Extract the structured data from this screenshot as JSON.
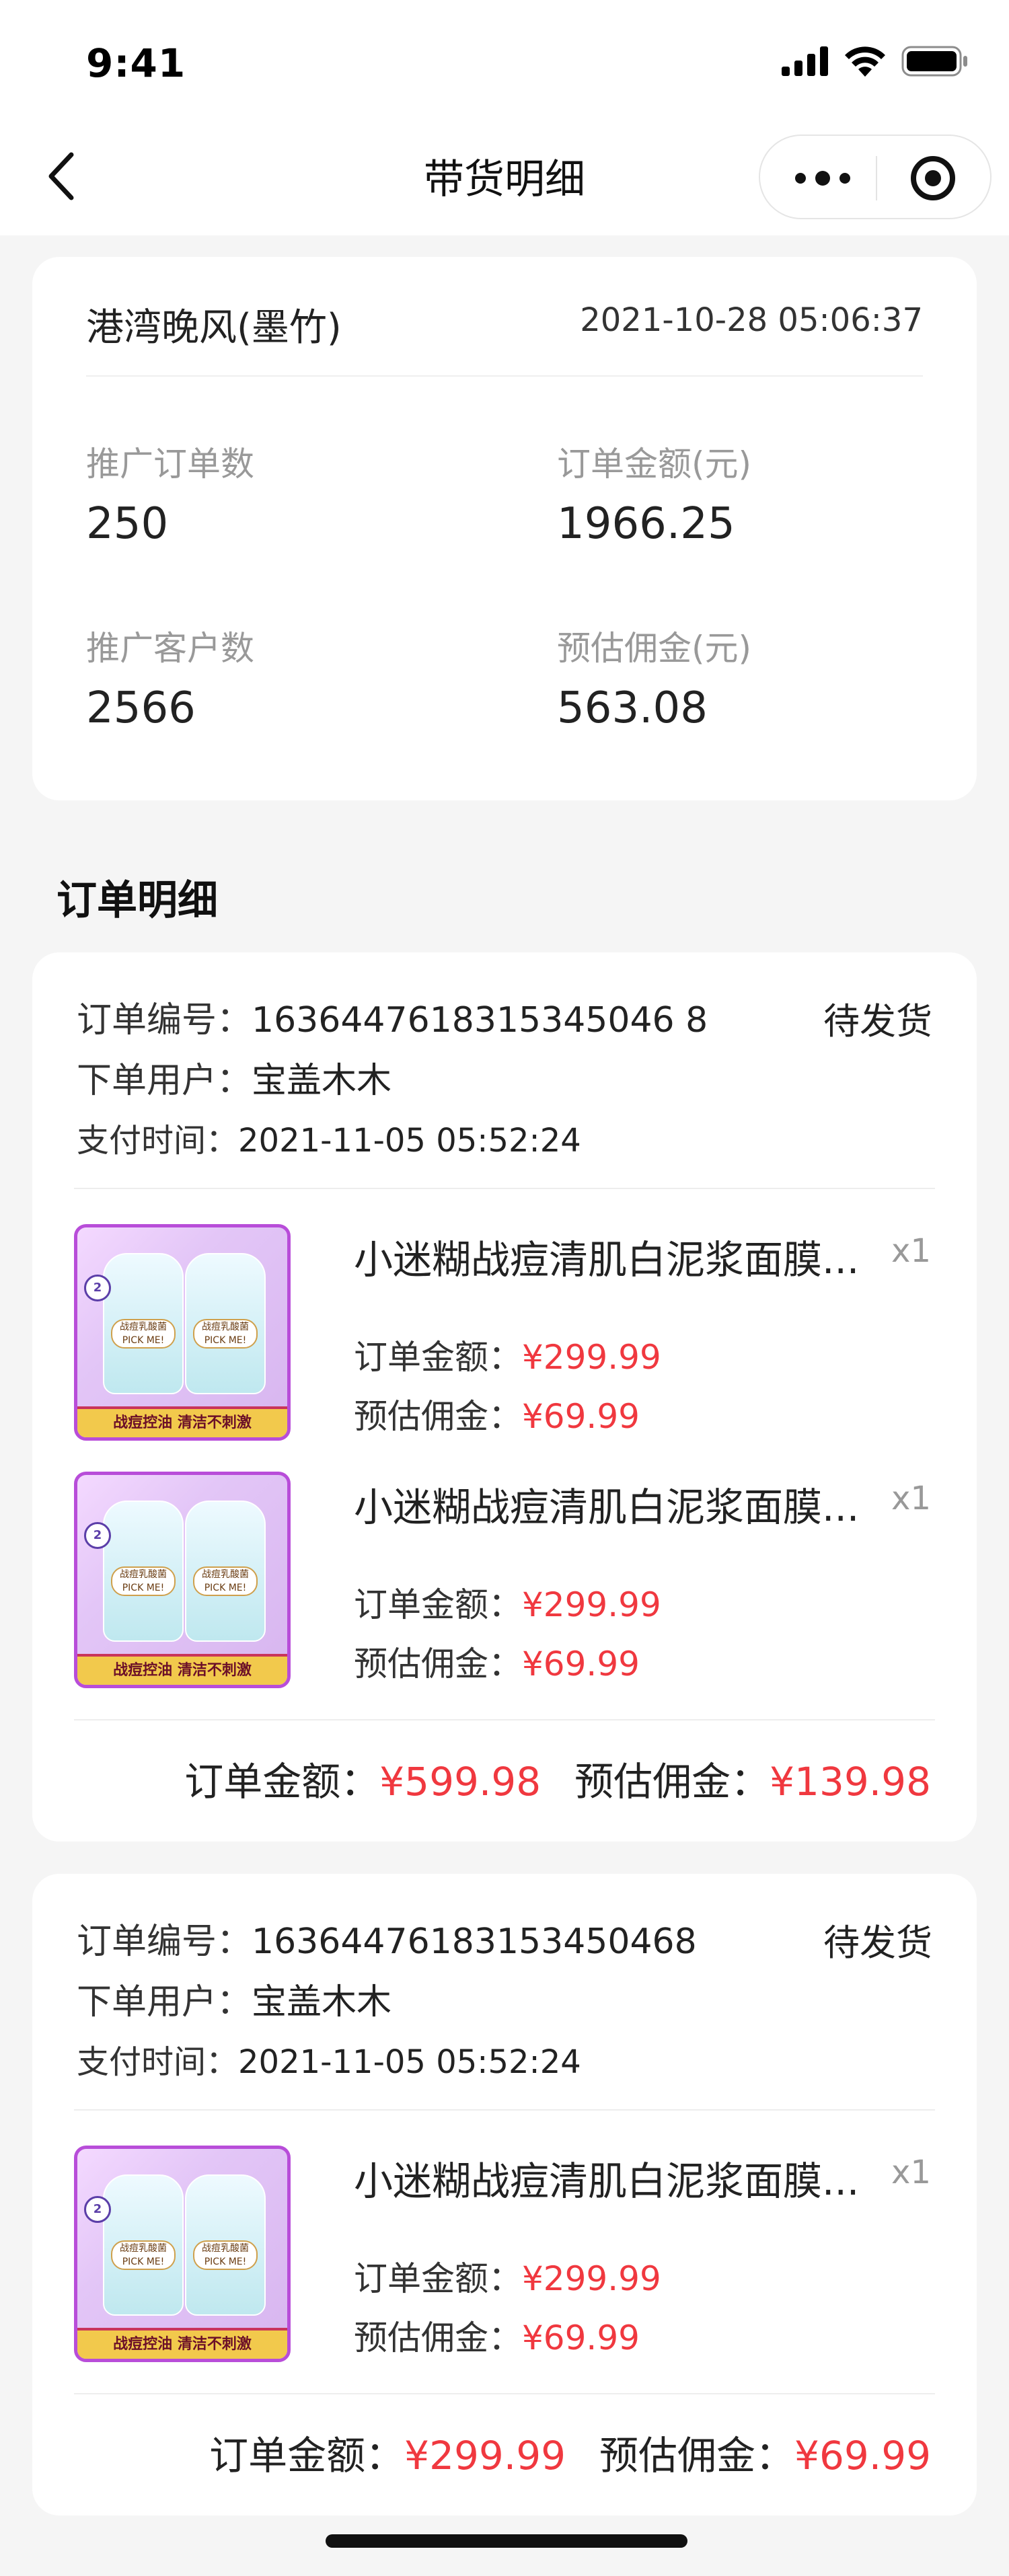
{
  "status_bar": {
    "time": "9:41"
  },
  "nav": {
    "title": "带货明细"
  },
  "summary": {
    "name": "港湾晚风(墨竹)",
    "datetime": "2021-10-28 05:06:37",
    "stats": [
      {
        "label": "推广订单数",
        "value": "250"
      },
      {
        "label": "订单金额(元)",
        "value": "1966.25"
      },
      {
        "label": "推广客户数",
        "value": "2566"
      },
      {
        "label": "预估佣金(元)",
        "value": "563.08"
      }
    ]
  },
  "section_title": "订单明细",
  "orders": [
    {
      "order_no_label": "订单编号：",
      "order_no": "1636447618315345046 8",
      "status": "待发货",
      "user_label": "下单用户：",
      "user": "宝盖木木",
      "pay_time_label": "支付时间：",
      "pay_time": "2021-11-05 05:52:24",
      "items": [
        {
          "title": "小迷糊战痘清肌白泥浆面膜...",
          "qty": "x1",
          "amount_label": "订单金额：",
          "amount": "¥299.99",
          "commission_label": "预估佣金：",
          "commission": "¥69.99"
        },
        {
          "title": "小迷糊战痘清肌白泥浆面膜...",
          "qty": "x1",
          "amount_label": "订单金额：",
          "amount": "¥299.99",
          "commission_label": "预估佣金：",
          "commission": "¥69.99"
        }
      ],
      "total_amount_label": "订单金额：",
      "total_amount": "¥599.98",
      "total_commission_label": "预估佣金：",
      "total_commission": "¥139.98"
    },
    {
      "order_no_label": "订单编号：",
      "order_no": "16364476183153450468",
      "status": "待发货",
      "user_label": "下单用户：",
      "user": "宝盖木木",
      "pay_time_label": "支付时间：",
      "pay_time": "2021-11-05 05:52:24",
      "items": [
        {
          "title": "小迷糊战痘清肌白泥浆面膜...",
          "qty": "x1",
          "amount_label": "订单金额：",
          "amount": "¥299.99",
          "commission_label": "预估佣金：",
          "commission": "¥69.99"
        }
      ],
      "total_amount_label": "订单金额：",
      "total_amount": "¥299.99",
      "total_commission_label": "预估佣金：",
      "total_commission": "¥69.99"
    }
  ],
  "product_image": {
    "badge": "2",
    "pouch_label": "战痘乳酸菌 PICK ME!",
    "banner": "战痘控油 清洁不刺激"
  },
  "colors": {
    "price_red": "#f0383f",
    "background": "#f5f5f5",
    "card": "#ffffff",
    "thumb_border": "#b84dd9"
  },
  "icons": [
    "signal-icon",
    "wifi-icon",
    "battery-icon",
    "back-arrow-icon",
    "more-icon",
    "close-target-icon"
  ]
}
